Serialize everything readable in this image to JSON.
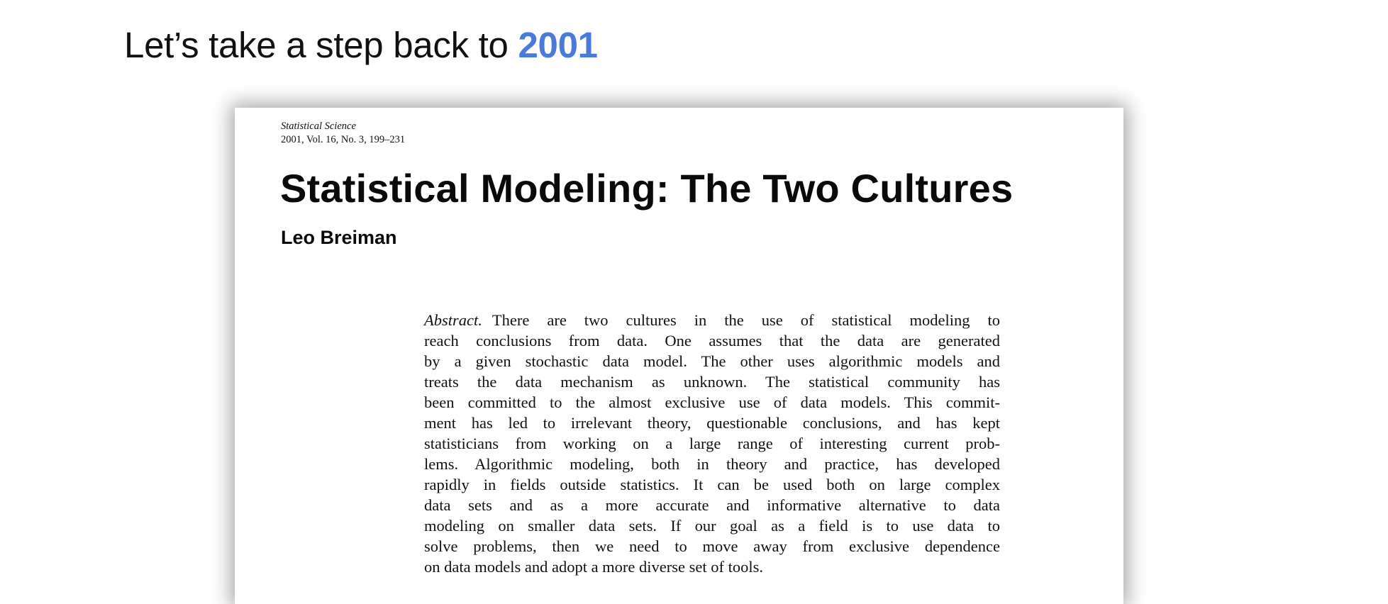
{
  "slide": {
    "heading_prefix": "Let’s take a step back to ",
    "heading_year": "2001",
    "accent_color": "#4a7bd8"
  },
  "paper": {
    "journal_name": "Statistical Science",
    "citation": "2001, Vol. 16, No. 3, 199–231",
    "title": "Statistical Modeling: The Two Cultures",
    "author": "Leo Breiman",
    "abstract_label": "Abstract.",
    "abstract_lines": [
      "There are two cultures in the use of statistical modeling to",
      "reach conclusions from data. One assumes that the data are generated",
      "by a given stochastic data model. The other uses algorithmic models and",
      "treats the data mechanism as unknown. The statistical community has",
      "been committed to the almost exclusive use of data models. This commit-",
      "ment has led to irrelevant theory, questionable conclusions, and has kept",
      "statisticians from working on a large range of interesting current prob-",
      "lems. Algorithmic modeling, both in theory and practice, has developed",
      "rapidly in fields outside statistics. It can be used both on large complex",
      "data sets and as a more accurate and informative alternative to data",
      "modeling on smaller data sets. If our goal as a field is to use data to",
      "solve problems, then we need to move away from exclusive dependence",
      "on data models and adopt a more diverse set of tools."
    ]
  }
}
